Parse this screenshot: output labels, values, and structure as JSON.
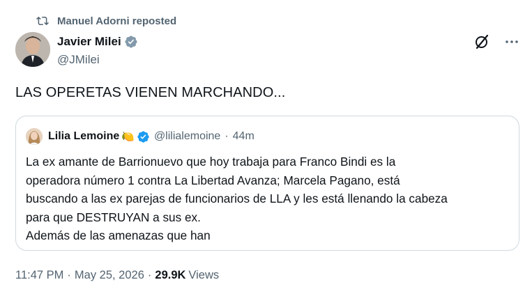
{
  "repost": {
    "label": "Manuel Adorni reposted"
  },
  "author": {
    "name": "Javier Milei",
    "handle": "@JMilei"
  },
  "tweet": {
    "text": "LAS OPERETAS VIENEN MARCHANDO..."
  },
  "quote": {
    "name": "Lilia Lemoine",
    "emoji": "🍋",
    "handle": "@lilialemoine",
    "dot": "·",
    "time": "44m",
    "lines": [
      "La ex amante de Barrionuevo que hoy trabaja para Franco Bindi es la",
      "operadora número 1 contra La Libertad Avanza; Marcela Pagano, está",
      "buscando a las ex parejas de funcionarios de LLA y les está llenando la cabeza",
      "para que DESTRUYAN a sus ex.",
      "Además de las amenazas que han"
    ]
  },
  "footer": {
    "time": "11:47 PM",
    "sep1": "·",
    "date": "May 25, 2026",
    "sep2": "·",
    "views_count": "29.9K",
    "views_label": "Views"
  },
  "icons": {
    "repost": "repost-icon",
    "verified": "verified-badge-icon",
    "grok": "grok-icon",
    "more": "more-icon"
  },
  "colors": {
    "text_primary": "#0f1419",
    "text_secondary": "#536471",
    "verified_blue": "#1d9bf0",
    "border": "#cfd9de"
  }
}
